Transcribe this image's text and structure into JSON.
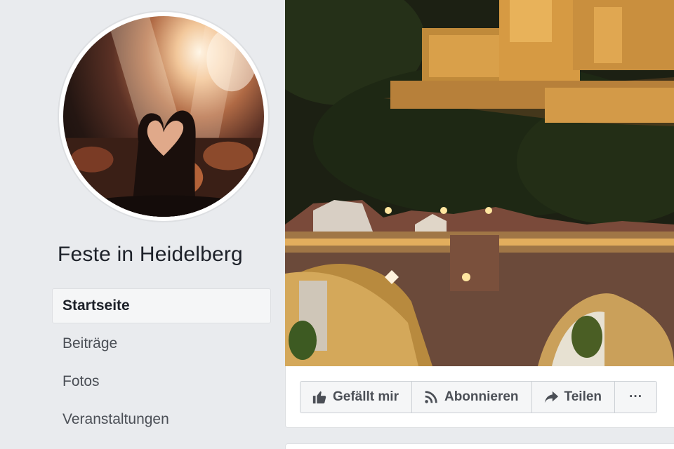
{
  "page": {
    "name": "Feste in Heidelberg"
  },
  "sidebar": {
    "items": [
      {
        "label": "Startseite",
        "active": true
      },
      {
        "label": "Beiträge",
        "active": false
      },
      {
        "label": "Fotos",
        "active": false
      },
      {
        "label": "Veranstaltungen",
        "active": false
      }
    ]
  },
  "actions": {
    "like_label": "Gefällt mir",
    "subscribe_label": "Abonnieren",
    "share_label": "Teilen",
    "more_label": "···"
  },
  "icons": {
    "like": "thumbs-up-icon",
    "subscribe": "rss-icon",
    "share": "share-arrow-icon",
    "more": "more-dots-icon"
  },
  "colors": {
    "background": "#e9ebee",
    "card": "#ffffff",
    "text_primary": "#1d2129",
    "text_secondary": "#4b4f56",
    "border": "#dddfe2"
  }
}
